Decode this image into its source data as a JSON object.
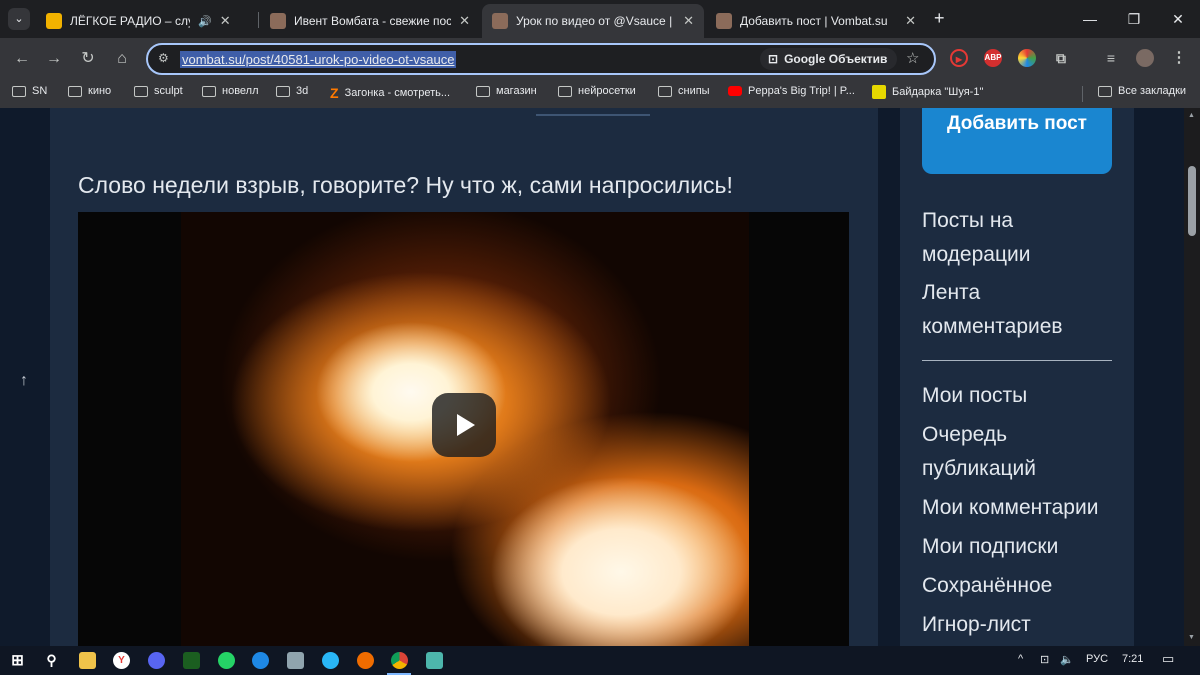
{
  "browser": {
    "tabs": [
      {
        "title": "ЛЁГКОЕ РАДИО – слушать",
        "favicon_color": "#f2b200",
        "audio_icon": "🔊",
        "active": false
      },
      {
        "title": "Ивент Вомбата - свежие пост",
        "favicon_color": "#8b6b5a",
        "active": false
      },
      {
        "title": "Урок по видео от @Vsauce | vo",
        "favicon_color": "#8b6b5a",
        "active": true
      },
      {
        "title": "Добавить пост | Vombat.su",
        "favicon_color": "#8b6b5a",
        "active": false
      }
    ],
    "close_glyph": "✕",
    "new_tab_glyph": "+",
    "window_controls": {
      "minimize": "—",
      "maximize": "❐",
      "close": "✕"
    },
    "toolbar": {
      "back": "←",
      "forward": "→",
      "reload": "↻",
      "home": "⌂",
      "site_info": "⚙",
      "url": "vombat.su/post/40581-urok-po-video-ot-vsauce",
      "lens_label": "Google Объектив",
      "lens_icon": "⊡",
      "star": "☆",
      "extensions": {
        "abp_label": "ABP"
      },
      "puzzle": "⧉",
      "media": "≡",
      "menu": "⋮"
    },
    "bookmarks": [
      {
        "label": "SN",
        "type": "folder"
      },
      {
        "label": "кино",
        "type": "folder"
      },
      {
        "label": "sculpt",
        "type": "folder"
      },
      {
        "label": "новелл",
        "type": "folder"
      },
      {
        "label": "3d",
        "type": "folder"
      },
      {
        "label": "Загонка - смотреть...",
        "type": "link",
        "icon_color": "#ff7a00"
      },
      {
        "label": "магазин",
        "type": "folder"
      },
      {
        "label": "нейросетки",
        "type": "folder"
      },
      {
        "label": "снипы",
        "type": "folder"
      },
      {
        "label": "Peppa's Big Trip! | P...",
        "type": "link",
        "icon_color": "#ff0000"
      },
      {
        "label": "Байдарка \"Шуя-1\"",
        "type": "link",
        "icon_color": "#e6d800"
      }
    ],
    "all_bookmarks": "Все закладки"
  },
  "page": {
    "post_text": "Слово недели взрыв, говорите? Ну что ж, сами напросились!",
    "scroll_up": "↑",
    "sidebar": {
      "add_post_label": "Добавить пост",
      "links_top": [
        "Посты на модерации",
        "Лента комментариев"
      ],
      "links_bottom": [
        "Мои посты",
        "Очередь публикаций",
        "Мои комментарии",
        "Мои подписки",
        "Сохранённое",
        "Игнор-лист"
      ]
    }
  },
  "taskbar": {
    "start": "⊞",
    "search": "⚲",
    "tray": {
      "chevron": "^",
      "lang": "РУС",
      "time": "7:21",
      "notifications": "▭",
      "volume": "🔈",
      "network": "⊡"
    }
  }
}
